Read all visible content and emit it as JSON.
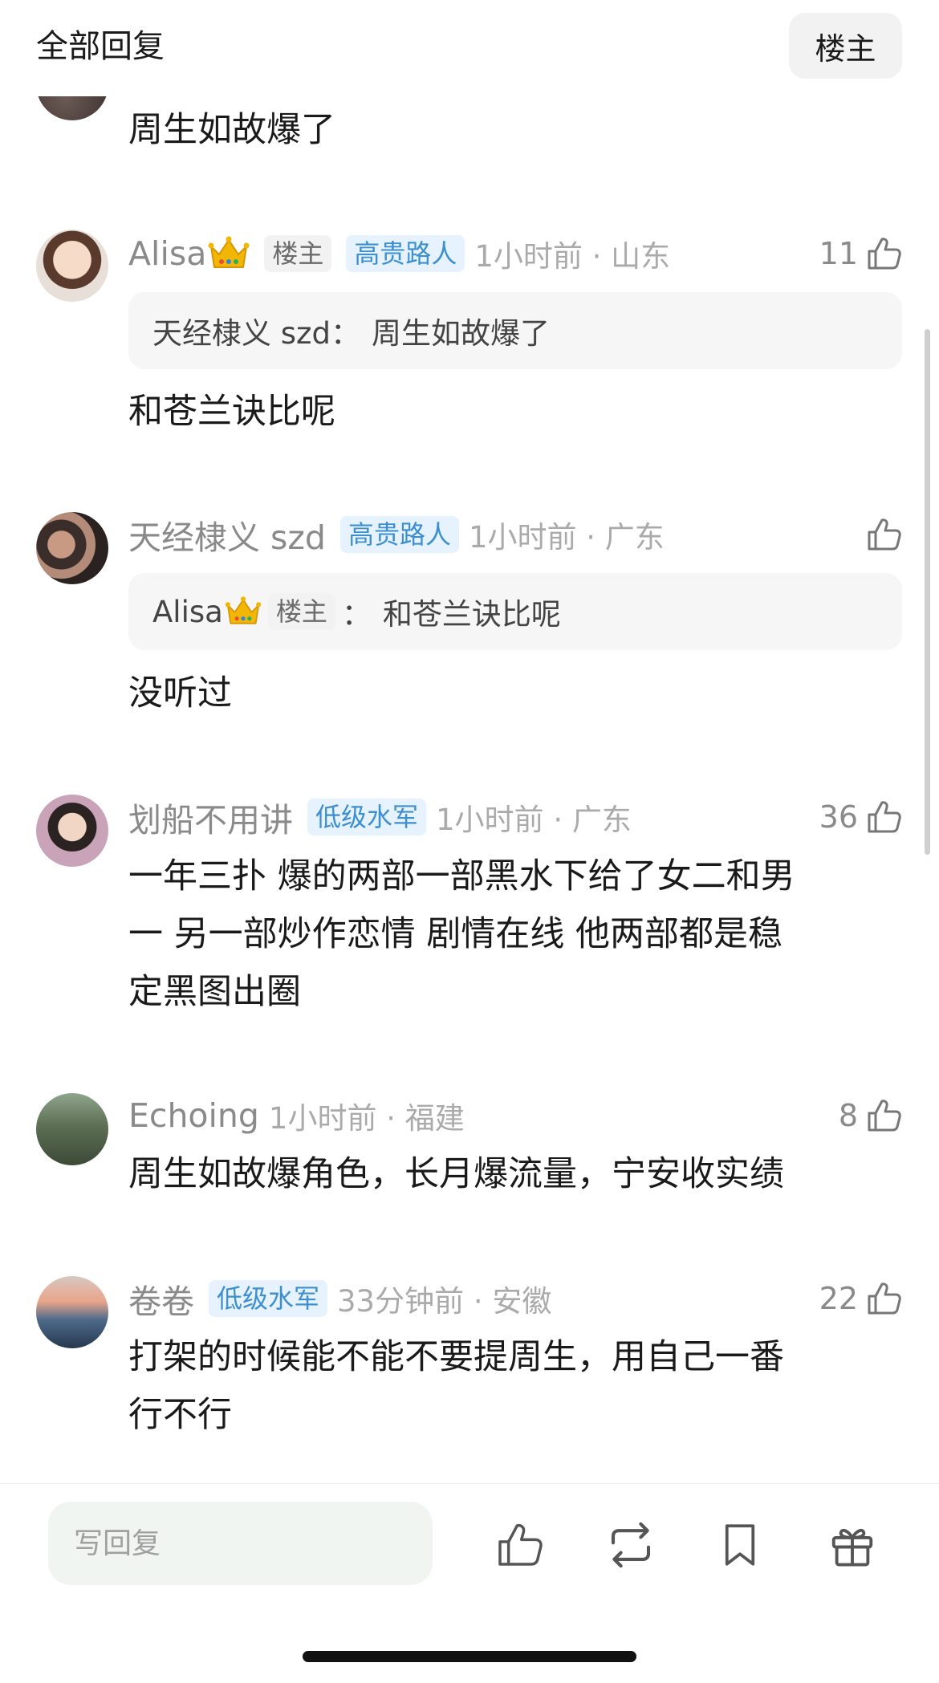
{
  "header": {
    "title": "全部回复",
    "op_button": "楼主"
  },
  "first_reply": {
    "text": "周生如故爆了"
  },
  "comments": [
    {
      "username": "Alisa",
      "has_crown": true,
      "badges": [
        "楼主",
        "高贵路人"
      ],
      "meta": "1小时前 · 山东",
      "likes": "11",
      "quote_user": "天经棣义 szd：",
      "quote_text": "周生如故爆了",
      "text_lines": [
        "和苍兰诀比呢"
      ]
    },
    {
      "username": "天经棣义 szd",
      "has_crown": false,
      "badges": [
        "高贵路人"
      ],
      "meta": "1小时前 · 广东",
      "likes": "",
      "quote_user": "Alisa",
      "quote_badge": "楼主",
      "quote_colon": "：",
      "quote_text": "和苍兰诀比呢",
      "text_lines": [
        "没听过"
      ]
    },
    {
      "username": "划船不用讲",
      "badges": [
        "低级水军"
      ],
      "meta": "1小时前 · 广东",
      "likes": "36",
      "text_lines": [
        "一年三扑 爆的两部一部黑水下给了女二和男",
        "一 另一部炒作恋情 剧情在线 他两部都是稳",
        "定黑图出圈"
      ]
    },
    {
      "username": "Echoing",
      "badges": [],
      "meta": "1小时前 · 福建",
      "likes": "8",
      "text_lines": [
        "周生如故爆角色，长月爆流量，宁安收实绩"
      ]
    },
    {
      "username": "卷卷",
      "badges": [
        "低级水军"
      ],
      "meta": "33分钟前 · 安徽",
      "likes": "22",
      "text_lines": [
        "打架的时候能不能不要提周生，用自己一番",
        "行不行"
      ]
    }
  ],
  "bottom_bar": {
    "reply_placeholder": "写回复",
    "icons": [
      "thumbs-up-icon",
      "repost-icon",
      "bookmark-icon",
      "gift-icon"
    ]
  },
  "colors": {
    "badge_blue_bg": "#e6f3ff",
    "badge_blue_text": "#3d8fcf",
    "meta_gray": "#8a8a8a",
    "quote_bg": "#f6f6f6"
  }
}
